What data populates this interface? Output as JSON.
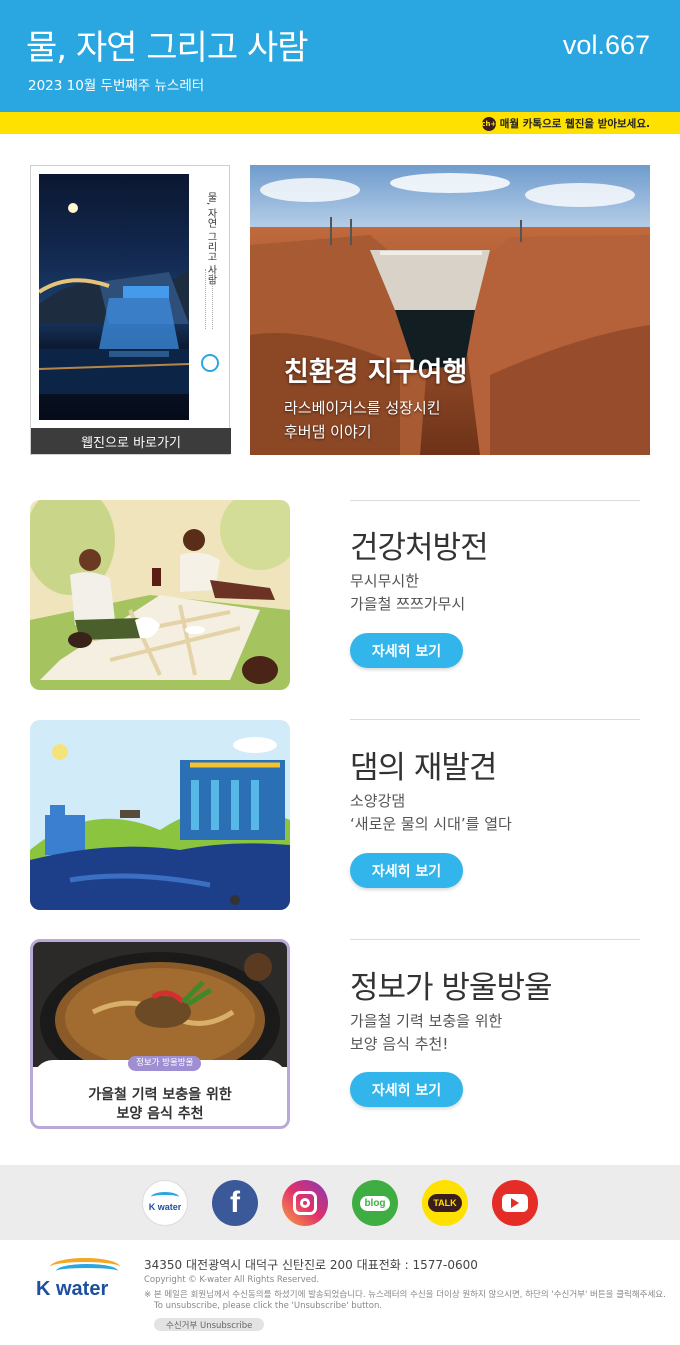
{
  "header": {
    "title": "물, 자연 그리고 사람",
    "subtitle": "2023 10월 두번째주 뉴스레터",
    "volume": "vol.667",
    "kakao_badge": "ch+",
    "kakao_text": "매월 카톡으로 웹진을 받아보세요."
  },
  "magazine": {
    "spine_title": "물, 자연 그리고 사람",
    "button_label": "웹진으로 바로가기"
  },
  "hero": {
    "title": "친환경 지구여행",
    "sub_line1": "라스베이거스를 성장시킨",
    "sub_line2": "후버댐 이야기"
  },
  "articles": [
    {
      "title": "건강처방전",
      "desc1": "무시무시한",
      "desc2": "가을철 쯔쯔가무시",
      "button": "자세히 보기"
    },
    {
      "title": "댐의 재발견",
      "desc1": "소양강댐",
      "desc2": "‘새로운 물의 시대’를 열다",
      "button": "자세히 보기"
    },
    {
      "title": "정보가 방울방울",
      "desc1": "가을철 기력 보충을 위한",
      "desc2": "보양 음식 추천!",
      "button": "자세히 보기"
    }
  ],
  "info_card": {
    "tag": "정보가 방울방울",
    "line1": "가을철 기력 보충을 위한",
    "line2": "보양 음식 추천"
  },
  "social": {
    "kwater_label": "K water",
    "facebook": "f",
    "blog": "blog",
    "talk": "TALK"
  },
  "footer": {
    "logo_text": "K water",
    "address": "34350 대전광역시 대덕구 신탄진로 200  대표전화 : 1577-0600",
    "copyright": "Copyright © K-water All Rights Reserved.",
    "note_ko": "※ 본 메일은 회원님께서 수신동의를 하셨기에 발송되었습니다. 뉴스레터의 수신을 더이상 원하지 않으시면, 하단의 '수신거부' 버튼을 클릭해주세요.",
    "note_en": "To unsubscribe, please click the 'Unsubscribe' button.",
    "unsubscribe": "수신거부  Unsubscribe"
  },
  "colors": {
    "header_blue": "#2aa7e1",
    "banner_yellow": "#ffe100",
    "button_blue": "#32b5ea"
  }
}
